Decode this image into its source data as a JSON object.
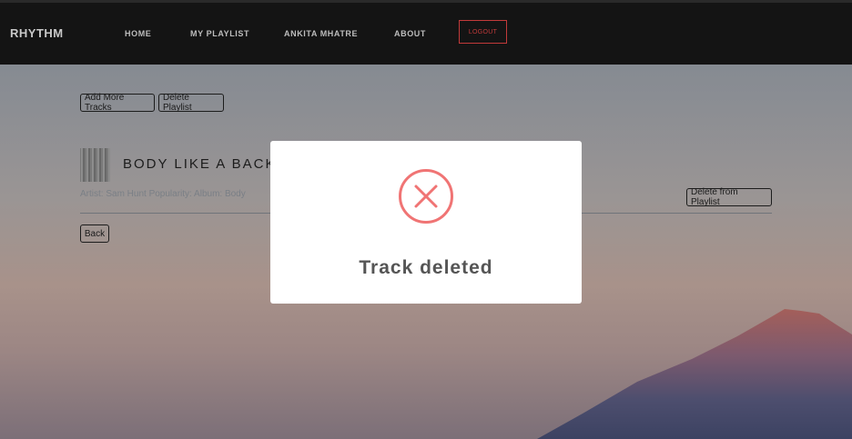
{
  "app": {
    "brand": "RHYTHM"
  },
  "nav": {
    "items": [
      {
        "label": "HOME"
      },
      {
        "label": "MY PLAYLIST"
      },
      {
        "label": "ANKITA MHATRE"
      },
      {
        "label": "ABOUT"
      }
    ],
    "logout_label": "LOGOUT"
  },
  "playlist": {
    "add_tracks_label": "Add More Tracks",
    "delete_playlist_label": "Delete Playlist",
    "track": {
      "title": "BODY LIKE A BACK",
      "meta": "Artist: Sam Hunt Popularity: Album: Body",
      "delete_label": "Delete from Playlist"
    },
    "back_label": "Back"
  },
  "modal": {
    "icon": "error-x-icon",
    "message": "Track deleted",
    "icon_color": "#f07474"
  },
  "colors": {
    "navbar": "#141414",
    "logout_accent": "#c23a3a",
    "modal_bg": "#ffffff"
  }
}
